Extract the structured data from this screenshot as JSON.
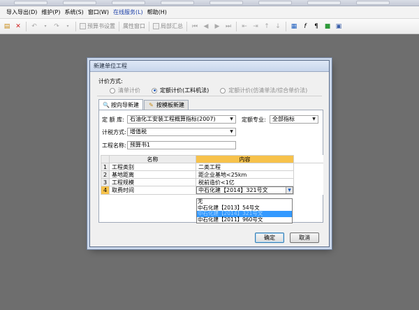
{
  "menubar": {
    "items": [
      {
        "label": "导入导出(D)"
      },
      {
        "label": "维护(P)"
      },
      {
        "label": "系统(S)"
      },
      {
        "label": "窗口(W)"
      },
      {
        "label": "在线服务(L)",
        "link": true
      },
      {
        "label": "帮助(H)"
      }
    ]
  },
  "toolbar": {
    "budget_settings": "预算书设置",
    "property_window": "属性窗口",
    "partial_summary": "局部汇总"
  },
  "dialog": {
    "title": "新建单位工程",
    "pricing_method_label": "计价方式:",
    "pricing_options": [
      {
        "label": "清单计价",
        "selected": false
      },
      {
        "label": "定额计价(工料机法)",
        "selected": true
      },
      {
        "label": "定额计价(仿清单法/综合单价法)",
        "selected": false
      }
    ],
    "tabs": [
      {
        "label": "按向导新建",
        "active": true
      },
      {
        "label": "按模板新建",
        "active": false
      }
    ],
    "form": {
      "quota_library_label": "定 额 库:",
      "quota_library_value": "石油化工安装工程概算指标(2007)",
      "quota_specialty_label": "定额专业:",
      "quota_specialty_value": "全部指标",
      "tax_method_label": "计税方式:",
      "tax_method_value": "增值税",
      "project_name_label": "工程名称:",
      "project_name_value": "预算书1"
    },
    "grid": {
      "col_name": "名称",
      "col_content": "内容",
      "rows": [
        {
          "num": "1",
          "name": "工程类别",
          "content": "二类工程"
        },
        {
          "num": "2",
          "name": "基地距离",
          "content": "距企业基地<25km"
        },
        {
          "num": "3",
          "name": "工程规模",
          "content": "税前造价<1亿"
        },
        {
          "num": "4",
          "name": "取费时间",
          "content": "中石化建【2014】321号文"
        }
      ]
    },
    "dropdown_options": [
      {
        "label": "无",
        "selected": false
      },
      {
        "label": "中石化建【2013】54号文",
        "selected": false
      },
      {
        "label": "中石化建【2014】321号文",
        "selected": true
      },
      {
        "label": "中石化建【2011】960号文",
        "selected": false
      }
    ],
    "ok_button": "确定",
    "cancel_button": "取消"
  }
}
